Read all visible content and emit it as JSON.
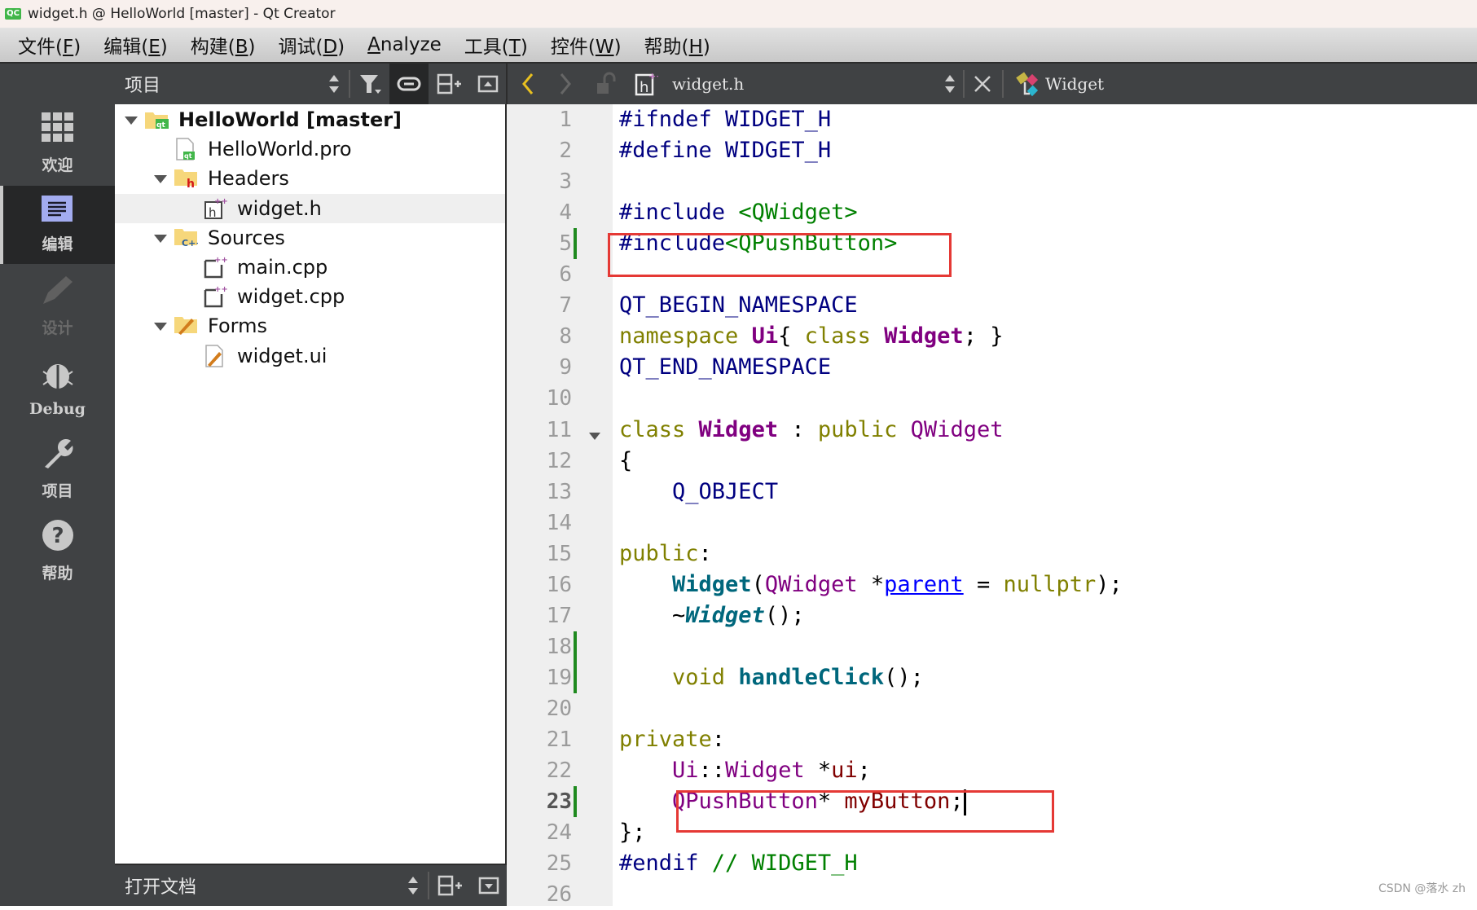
{
  "window": {
    "title": "widget.h @ HelloWorld [master] - Qt Creator",
    "app_icon": "QC"
  },
  "menu": [
    {
      "label": "文件(",
      "key": "F",
      "end": ")"
    },
    {
      "label": "编辑(",
      "key": "E",
      "end": ")"
    },
    {
      "label": "构建(",
      "key": "B",
      "end": ")"
    },
    {
      "label": "调试(",
      "key": "D",
      "end": ")"
    },
    {
      "label": "",
      "key": "A",
      "end": "nalyze"
    },
    {
      "label": "工具(",
      "key": "T",
      "end": ")"
    },
    {
      "label": "控件(",
      "key": "W",
      "end": ")"
    },
    {
      "label": "帮助(",
      "key": "H",
      "end": ")"
    }
  ],
  "project_panel": {
    "selector_label": "项目",
    "open_docs_label": "打开文档"
  },
  "editor_toolbar": {
    "file_name": "widget.h",
    "symbol": "Widget"
  },
  "modes": [
    {
      "label": "欢迎",
      "icon": "grid-icon",
      "state": "normal"
    },
    {
      "label": "编辑",
      "icon": "edit-icon",
      "state": "active"
    },
    {
      "label": "设计",
      "icon": "pencil-icon",
      "state": "disabled"
    },
    {
      "label": "Debug",
      "icon": "bug-icon",
      "state": "normal"
    },
    {
      "label": "项目",
      "icon": "wrench-icon",
      "state": "normal"
    },
    {
      "label": "帮助",
      "icon": "help-icon",
      "state": "normal"
    }
  ],
  "tree": [
    {
      "label": "HelloWorld [master]",
      "level": 0,
      "type": "project",
      "expanded": true,
      "bold": true
    },
    {
      "label": "HelloWorld.pro",
      "level": 1,
      "type": "pro"
    },
    {
      "label": "Headers",
      "level": 1,
      "type": "folder-h",
      "expanded": true
    },
    {
      "label": "widget.h",
      "level": 2,
      "type": "header",
      "selected": true
    },
    {
      "label": "Sources",
      "level": 1,
      "type": "folder-cpp",
      "expanded": true
    },
    {
      "label": "main.cpp",
      "level": 2,
      "type": "cpp"
    },
    {
      "label": "widget.cpp",
      "level": 2,
      "type": "cpp"
    },
    {
      "label": "Forms",
      "level": 1,
      "type": "folder-ui",
      "expanded": true
    },
    {
      "label": "widget.ui",
      "level": 2,
      "type": "ui"
    }
  ],
  "code": {
    "current_line": 23,
    "changed_lines": [
      5,
      18,
      19,
      23
    ],
    "lines": [
      [
        [
          "pp",
          "#ifndef WIDGET_H"
        ]
      ],
      [
        [
          "pp",
          "#define WIDGET_H"
        ]
      ],
      [],
      [
        [
          "pp",
          "#include "
        ],
        [
          "str",
          "<QWidget>"
        ]
      ],
      [
        [
          "pp",
          "#include"
        ],
        [
          "str",
          "<QPushButton>"
        ]
      ],
      [],
      [
        [
          "pp",
          "QT_BEGIN_NAMESPACE"
        ]
      ],
      [
        [
          "kw",
          "namespace "
        ],
        [
          "tyb",
          "Ui"
        ],
        [
          "",
          "{ "
        ],
        [
          "kw",
          "class "
        ],
        [
          "tyb",
          "Widget"
        ],
        [
          "",
          "; }"
        ]
      ],
      [
        [
          "pp",
          "QT_END_NAMESPACE"
        ]
      ],
      [],
      [
        [
          "kw",
          "class "
        ],
        [
          "tyb",
          "Widget"
        ],
        [
          "",
          " : "
        ],
        [
          "kw",
          "public "
        ],
        [
          "ty",
          "QWidget"
        ]
      ],
      [
        [
          "",
          "{"
        ]
      ],
      [
        [
          "",
          "    "
        ],
        [
          "pp",
          "Q_OBJECT"
        ]
      ],
      [],
      [
        [
          "kw",
          "public"
        ],
        [
          "",
          ":"
        ]
      ],
      [
        [
          "",
          "    "
        ],
        [
          "fn",
          "Widget"
        ],
        [
          "",
          "("
        ],
        [
          "ty",
          "QWidget"
        ],
        [
          "",
          " *"
        ],
        [
          "par",
          "parent"
        ],
        [
          "",
          " = "
        ],
        [
          "kw",
          "nullptr"
        ],
        [
          "",
          ");"
        ]
      ],
      [
        [
          "",
          "    ~"
        ],
        [
          "fni",
          "Widget"
        ],
        [
          "",
          "();"
        ]
      ],
      [],
      [
        [
          "",
          "    "
        ],
        [
          "kw",
          "void "
        ],
        [
          "fn",
          "handleClick"
        ],
        [
          "",
          "();"
        ]
      ],
      [],
      [
        [
          "kw",
          "private"
        ],
        [
          "",
          ":"
        ]
      ],
      [
        [
          "",
          "    "
        ],
        [
          "ty",
          "Ui"
        ],
        [
          "",
          "::"
        ],
        [
          "ty",
          "Widget"
        ],
        [
          "",
          " *"
        ],
        [
          "mem",
          "ui"
        ],
        [
          "",
          ";"
        ]
      ],
      [
        [
          "",
          "    "
        ],
        [
          "ty",
          "QPushButton"
        ],
        [
          "",
          "* "
        ],
        [
          "mem",
          "myButton"
        ],
        [
          "",
          ";"
        ]
      ],
      [
        [
          "",
          "};"
        ]
      ],
      [
        [
          "pp",
          "#endif "
        ],
        [
          "cm",
          "// WIDGET_H"
        ]
      ],
      []
    ]
  },
  "watermark": "CSDN @落水 zh"
}
